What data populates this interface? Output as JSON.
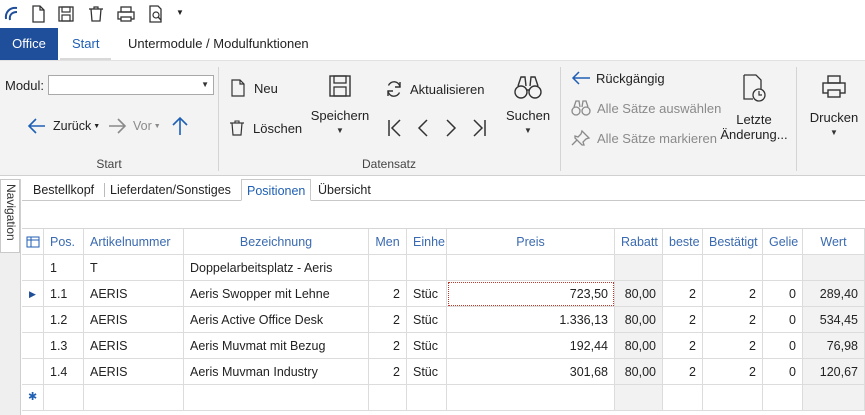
{
  "quick_access": {
    "icons": [
      "logo-icon",
      "new-document-icon",
      "save-icon",
      "delete-icon",
      "print-icon",
      "print-preview-icon",
      "customize-dropdown-icon"
    ]
  },
  "ribbon_tabs": {
    "office": "Office",
    "start": "Start",
    "modules": "Untermodule / Modulfunktionen"
  },
  "ribbon": {
    "start_group": {
      "modul_label": "Modul:",
      "modul_value": "",
      "back": "Zurück",
      "forward": "Vor",
      "label": "Start"
    },
    "record_group": {
      "new": "Neu",
      "delete": "Löschen",
      "save": "Speichern",
      "refresh": "Aktualisieren",
      "search": "Suchen",
      "label": "Datensatz"
    },
    "history_group": {
      "undo": "Rückgängig",
      "select_all": "Alle Sätze auswählen",
      "mark_all": "Alle Sätze markieren",
      "last_changes_line1": "Letzte",
      "last_changes_line2": "Änderung..."
    },
    "print_group": {
      "print": "Drucken"
    }
  },
  "navigation": {
    "label": "Navigation"
  },
  "doc_tabs": [
    "Bestellkopf",
    "Lieferdaten/Sonstiges",
    "Positionen",
    "Übersicht"
  ],
  "grid": {
    "headers": [
      "Pos.",
      "Artikelnummer",
      "Bezeichnung",
      "Men",
      "Einhe",
      "Preis",
      "Rabatt",
      "beste",
      "Bestätigt",
      "Gelie",
      "Wert"
    ],
    "rows": [
      [
        "1",
        "T",
        "Doppelarbeitsplatz - Aeris",
        "",
        "",
        "",
        "",
        "",
        "",
        "",
        ""
      ],
      [
        "1.1",
        "AERIS",
        "Aeris Swopper mit Lehne",
        "2",
        "Stüc",
        "723,50",
        "80,00",
        "2",
        "2",
        "0",
        "289,40"
      ],
      [
        "1.2",
        "AERIS",
        "Aeris Active Office Desk",
        "2",
        "Stüc",
        "1.336,13",
        "80,00",
        "2",
        "2",
        "0",
        "534,45"
      ],
      [
        "1.3",
        "AERIS",
        "Aeris Muvmat mit Bezug",
        "2",
        "Stüc",
        "192,44",
        "80,00",
        "2",
        "2",
        "0",
        "76,98"
      ],
      [
        "1.4",
        "AERIS",
        "Aeris Muvman Industry",
        "2",
        "Stüc",
        "301,68",
        "80,00",
        "2",
        "2",
        "0",
        "120,67"
      ]
    ],
    "current_row_marker": "▶",
    "new_row_marker": "✱"
  },
  "colors": {
    "office_tab": "#1f4e9a",
    "accent_text": "#1f5fb4",
    "header_text": "#3a6ab0"
  }
}
